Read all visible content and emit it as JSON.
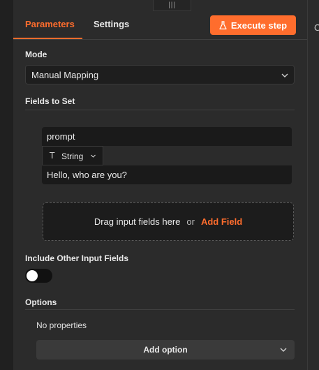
{
  "drag_handle": {
    "glyph": "|||"
  },
  "tabs": [
    {
      "label": "Parameters",
      "active": true
    },
    {
      "label": "Settings",
      "active": false
    }
  ],
  "execute_button": {
    "label": "Execute step",
    "icon": "flask-icon"
  },
  "mode": {
    "label": "Mode",
    "value": "Manual Mapping"
  },
  "fields": {
    "label": "Fields to Set",
    "items": [
      {
        "name": "prompt",
        "type": "String",
        "type_icon": "T",
        "value": "Hello, who are you?"
      }
    ],
    "drop_zone": {
      "text": "Drag input fields here",
      "or": "or",
      "add_link": "Add Field"
    }
  },
  "include_other": {
    "label": "Include Other Input Fields",
    "enabled": false
  },
  "options": {
    "label": "Options",
    "empty_text": "No properties",
    "add_label": "Add option"
  },
  "colors": {
    "accent": "#ff6d2d",
    "background": "#2b2b2b",
    "input_bg": "#1a1a1a"
  }
}
